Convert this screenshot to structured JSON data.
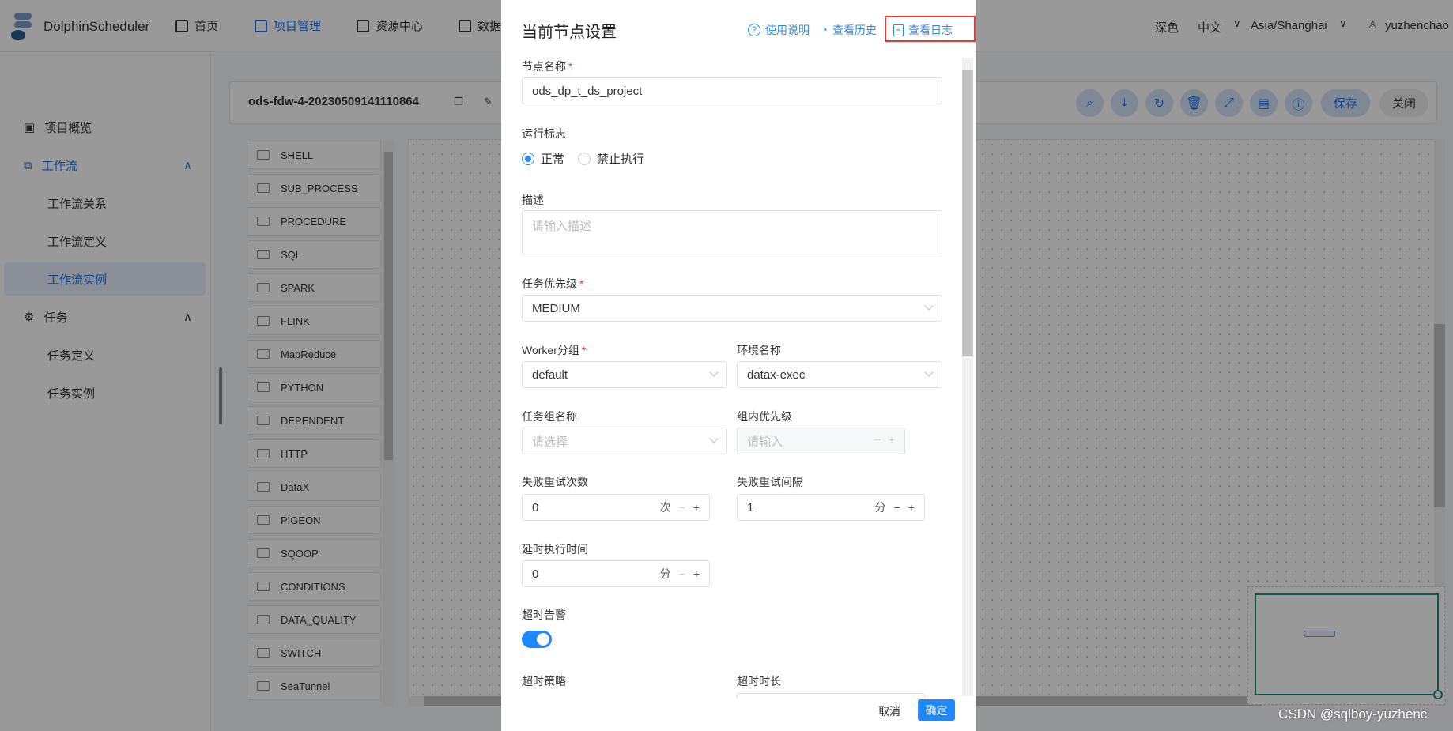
{
  "header": {
    "brand": "DolphinScheduler",
    "nav": [
      "首页",
      "项目管理",
      "资源中心",
      "数据"
    ],
    "theme": "深色",
    "language": "中文",
    "timezone": "Asia/Shanghai",
    "user": "yuzhenchao"
  },
  "sidebar": {
    "items": [
      "项目概览",
      "工作流",
      "工作流关系",
      "工作流定义",
      "工作流实例",
      "任务",
      "任务定义",
      "任务实例"
    ]
  },
  "workflow": {
    "title": "ods-fdw-4-20230509141110864",
    "save": "保存",
    "close": "关闭"
  },
  "toolbar_icons": [
    "search-icon",
    "download-icon",
    "refresh-icon",
    "delete-icon",
    "fullscreen-icon",
    "format-icon",
    "info-icon"
  ],
  "tasks": [
    "SHELL",
    "SUB_PROCESS",
    "PROCEDURE",
    "SQL",
    "SPARK",
    "FLINK",
    "MapReduce",
    "PYTHON",
    "DEPENDENT",
    "HTTP",
    "DataX",
    "PIGEON",
    "SQOOP",
    "CONDITIONS",
    "DATA_QUALITY",
    "SWITCH",
    "SeaTunnel"
  ],
  "modal": {
    "title": "当前节点设置",
    "help": "使用说明",
    "history": "查看历史",
    "log": "查看日志",
    "node_name_label": "节点名称",
    "node_name": "ods_dp_t_ds_project",
    "run_flag_label": "运行标志",
    "run_normal": "正常",
    "run_forbid": "禁止执行",
    "desc_label": "描述",
    "desc_placeholder": "请输入描述",
    "priority_label": "任务优先级",
    "priority": "MEDIUM",
    "worker_label": "Worker分组",
    "worker": "default",
    "env_label": "环境名称",
    "env": "datax-exec",
    "task_group_label": "任务组名称",
    "task_group_placeholder": "请选择",
    "group_priority_label": "组内优先级",
    "group_priority_placeholder": "请输入",
    "retry_times_label": "失败重试次数",
    "retry_times": "0",
    "retry_times_unit": "次",
    "retry_interval_label": "失败重试间隔",
    "retry_interval": "1",
    "retry_interval_unit": "分",
    "delay_label": "延时执行时间",
    "delay": "0",
    "delay_unit": "分",
    "timeout_alarm_label": "超时告警",
    "timeout_alarm_on": true,
    "timeout_strategy_label": "超时策略",
    "timeout_duration_label": "超时时长",
    "cancel": "取消",
    "confirm": "确定"
  },
  "watermark": "CSDN @sqlboy-yuzhenc",
  "colors": {
    "accent": "#1a73e8",
    "link": "#2d8cf0",
    "highlight_box": "#e53935",
    "minimap": "#1f8a7a"
  }
}
